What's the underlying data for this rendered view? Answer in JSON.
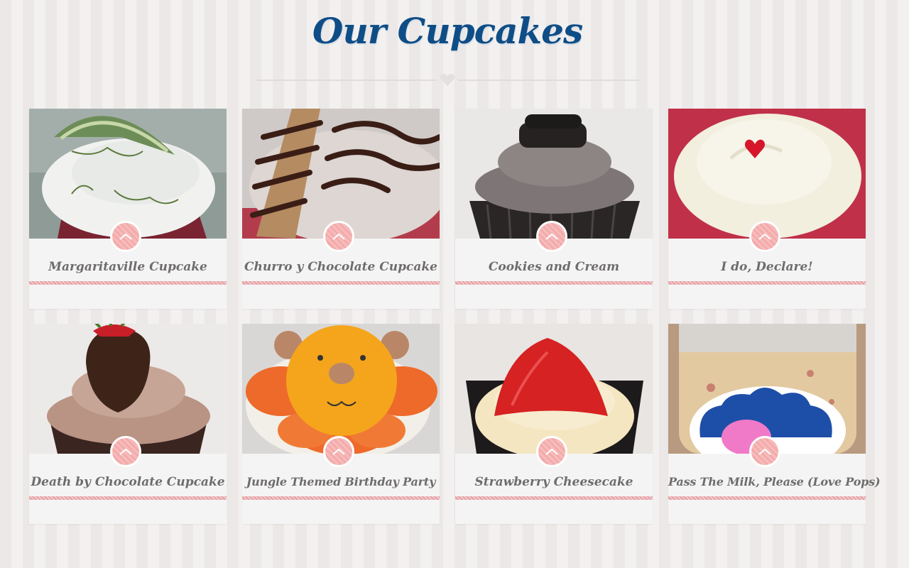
{
  "page": {
    "title": "Our Cupcakes"
  },
  "colors": {
    "title": "#0f4d86",
    "accent_pink": "#f4a9a9",
    "stripe_pink": "#e6a2a6",
    "card_bg": "#f5f4f4",
    "card_title": "#6e6c6c"
  },
  "icons": {
    "divider": "heart-icon",
    "card_pin": "chevron-up-icon"
  },
  "cupcakes": [
    {
      "name": "Margaritaville Cupcake"
    },
    {
      "name": "Churro y Chocolate Cupcake"
    },
    {
      "name": "Cookies and Cream"
    },
    {
      "name": "I do, Declare!"
    },
    {
      "name": "Death by Chocolate Cupcake"
    },
    {
      "name": "Jungle Themed Birthday Party"
    },
    {
      "name": "Strawberry Cheesecake"
    },
    {
      "name": "Pass The Milk, Please (Love Pops)"
    }
  ]
}
